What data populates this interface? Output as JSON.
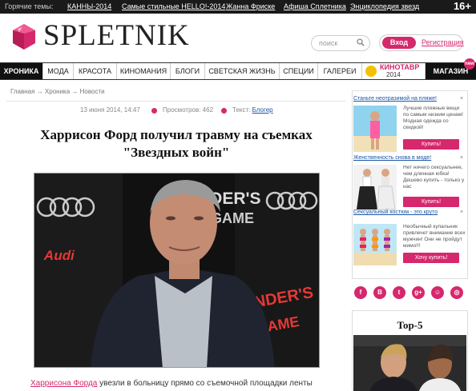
{
  "topbar": {
    "label": "Горячие темы:",
    "links": [
      "КАННЫ-2014",
      "Самые стильные HELLO!-2014",
      "Жанна Фриске",
      "Афиша Сплетника",
      "Энциклопедия звезд"
    ],
    "age": "16+"
  },
  "header": {
    "logo_text": "SPLETNIK",
    "search_placeholder": "поиск",
    "login_label": "Вход",
    "register_label": "Регистрация"
  },
  "nav": {
    "items": [
      "ХРОНИКА",
      "МОДА",
      "КРАСОТА",
      "КИНОМАНИЯ",
      "БЛОГИ",
      "СВЕТСКАЯ ЖИЗНЬ",
      "СПЕЦИИ",
      "ГАЛЕРЕИ"
    ],
    "kino_line1": "КИНОТАВР",
    "kino_line2": "2014",
    "shop_label": "МАГАЗИН",
    "shop_badge": "new"
  },
  "breadcrumbs": [
    "Главная",
    "Хроника",
    "Новости"
  ],
  "article": {
    "date": "13 июня 2014, 14:47",
    "views_label": "Просмотров: 462",
    "text_label": "Текст:",
    "author": "Блогер",
    "title": "Харрисон Форд получил травму на съемках \"Звездных войн\"",
    "photo_sign_1": "ENDER'S",
    "photo_sign_2": "GAME",
    "photo_brand": "Audi",
    "lead_link": "Харрисона Форда",
    "lead_text": " увезли в больницу прямо со съемочной площадки ленты"
  },
  "sidebar": {
    "ads": [
      {
        "title": "Станьте неотразимой на пляже!",
        "text": "Лучшие пляжные вещи по самым низким ценам! Модная одежда со скидкой!",
        "button": "Купить!"
      },
      {
        "title": "Женственность снова в моде!",
        "text": "Нет ничего сексуальнее, чем длинная юбка! Дешево купить - только у нас",
        "button": "Купить!"
      },
      {
        "title": "Сексуальный костюм - это круто",
        "text": "Необычный купальник привлечет внимание всех мужчин! Они не пройдут мимо!!!",
        "button": "Хочу купить!"
      }
    ],
    "close_glyph": "×",
    "social_icons": [
      "f",
      "B",
      "t",
      "g+",
      "☺",
      "◎"
    ],
    "top5_title": "Top-5"
  }
}
